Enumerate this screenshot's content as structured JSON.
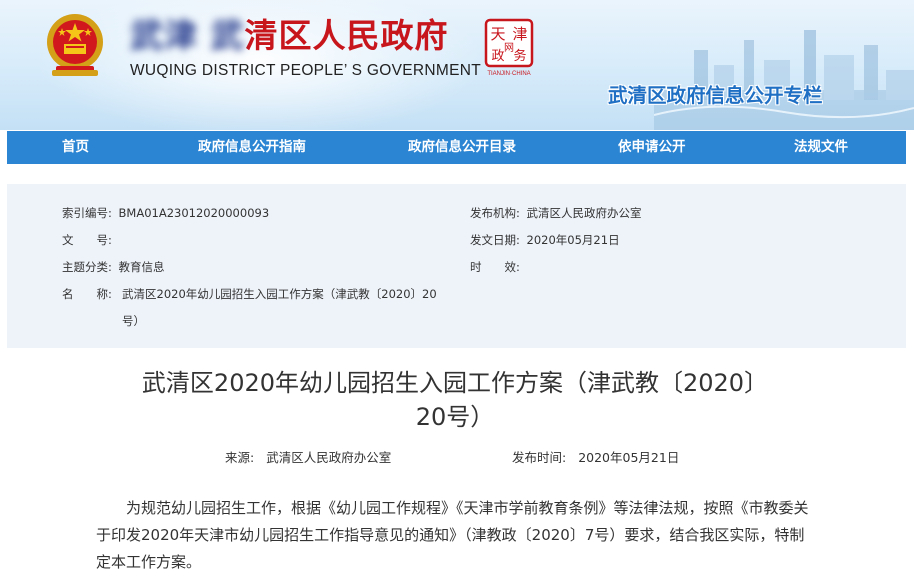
{
  "header": {
    "site_title_cn_visible": "清区人民政府",
    "site_title_en": "WUQING DISTRICT PEOPLE’ S GOVERNMENT",
    "seal_chars": [
      "天",
      "津",
      "政",
      "务",
      "网"
    ],
    "seal_caption": "TIANJIN·CHINA",
    "subtitle": "武清区政府信息公开专栏"
  },
  "nav": {
    "items": [
      {
        "label": "首页"
      },
      {
        "label": "政府信息公开指南"
      },
      {
        "label": "政府信息公开目录"
      },
      {
        "label": "依申请公开"
      },
      {
        "label": "法规文件"
      }
    ]
  },
  "info": {
    "index_label": "索引编号:",
    "index_value": "BMA01A23012020000093",
    "doc_no_label": "文　　号:",
    "doc_no_value": "",
    "topic_label": "主题分类:",
    "topic_value": "教育信息",
    "name_label": "名　　称:",
    "name_value_line1": "武清区2020年幼儿园招生入园工作方案（津武教〔2020〕20",
    "name_value_line2": "号）",
    "org_label": "发布机构:",
    "org_value": "武清区人民政府办公室",
    "date_label": "发文日期:",
    "date_value": "2020年05月21日",
    "valid_label": "时　　效:",
    "valid_value": ""
  },
  "article": {
    "title_line1": "武清区2020年幼儿园招生入园工作方案（津武教〔2020〕",
    "title_line2": "20号）",
    "source_label": "来源:",
    "source_value": "武清区人民政府办公室",
    "pubtime_label": "发布时间:",
    "pubtime_value": "2020年05月21日",
    "paragraph": "为规范幼儿园招生工作，根据《幼儿园工作规程》《天津市学前教育条例》等法律法规，按照《市教委关于印发2020年天津市幼儿园招生工作指导意见的通知》（津教政〔2020〕7号）要求，结合我区实际，特制定本工作方案。"
  },
  "colors": {
    "title_red": "#c8161d",
    "subtitle_blue": "#1f6fc4",
    "nav_blue": "#2b85d3",
    "info_bg": "#eef3fa"
  }
}
